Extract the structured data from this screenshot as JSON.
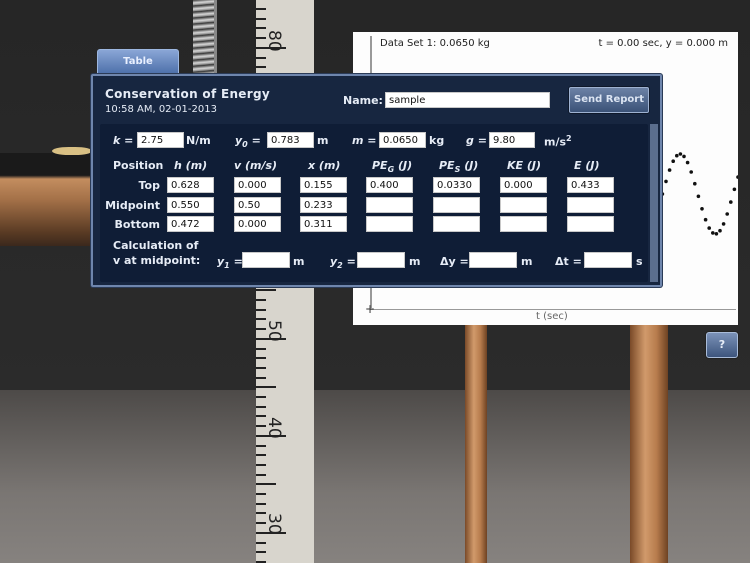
{
  "window": {
    "tab_label": "Table",
    "help_label": "?"
  },
  "ruler": {
    "labels": [
      "80",
      "50",
      "40",
      "30"
    ]
  },
  "graph": {
    "title": "Data Set 1: 0.0650 kg",
    "readout": "t = 0.00 sec,  y = 0.000 m",
    "x_axis_label": "t (sec)",
    "origin_mark": "+"
  },
  "panel": {
    "title": "Conservation of Energy",
    "datetime": "10:58 AM, 02-01-2013",
    "name_label": "Name:",
    "name_value": "sample",
    "send_report_label": "Send Report",
    "params": {
      "k_label": "k =",
      "k_value": "2.75",
      "k_unit": "N/m",
      "y0_label": "y",
      "y0_sub": "0",
      "y0_eq": "=",
      "y0_value": "0.783",
      "y0_unit": "m",
      "m_label": "m =",
      "m_value": "0.0650",
      "m_unit": "kg",
      "g_label": "g =",
      "g_value": "9.80",
      "g_unit": "m/s",
      "g_unit_sup": "2"
    },
    "table": {
      "headers": [
        "Position",
        "h (m)",
        "v (m/s)",
        "x (m)",
        "PE",
        "PE",
        "KE (J)",
        "E (J)"
      ],
      "header_subs": {
        "peg": "G",
        "pes": "S"
      },
      "header_unit": "(J)",
      "rows": [
        {
          "position": "Top",
          "h": "0.628",
          "v": "0.000",
          "x": "0.155",
          "peg": "0.400",
          "pes": "0.0330",
          "ke": "0.000",
          "e": "0.433"
        },
        {
          "position": "Midpoint",
          "h": "0.550",
          "v": "0.50",
          "x": "0.233",
          "peg": "",
          "pes": "",
          "ke": "",
          "e": ""
        },
        {
          "position": "Bottom",
          "h": "0.472",
          "v": "0.000",
          "x": "0.311",
          "peg": "",
          "pes": "",
          "ke": "",
          "e": ""
        }
      ]
    },
    "calc": {
      "label_line1": "Calculation of",
      "label_line2": "v at midpoint:",
      "y1_label": "y",
      "y1_sub": "1",
      "y1_value": "",
      "y1_unit": "m",
      "y2_label": "y",
      "y2_sub": "2",
      "y2_value": "",
      "y2_unit": "m",
      "dy_label": "Δy =",
      "dy_value": "",
      "dy_unit": "m",
      "dt_label": "Δt =",
      "dt_value": "",
      "dt_unit": "s",
      "eq": "="
    }
  }
}
